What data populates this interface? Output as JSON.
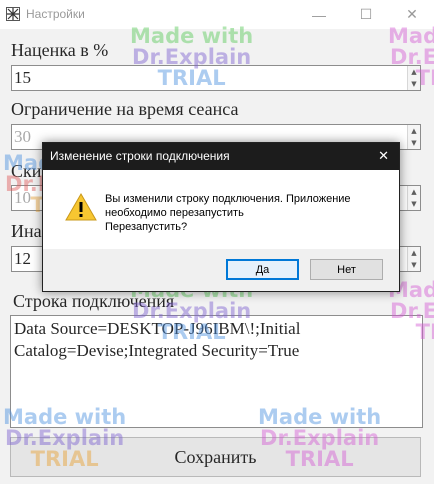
{
  "window": {
    "title": "Настройки",
    "minimize": "—",
    "maximize": "☐",
    "close": "✕"
  },
  "form": {
    "markup_label": "Наценка в %",
    "markup_value": "15",
    "session_limit_label": "Ограничение на время сеанса",
    "session_limit_value": "30",
    "discount_label": "Ски",
    "discount_value": "10",
    "other_label": "Ина",
    "other_value": "12",
    "connection_label": "Строка подключения",
    "connection_string": "Data Source=DESKTOP-J96IBM\\!;Initial Catalog=Devise;Integrated Security=True",
    "save_label": "Сохранить"
  },
  "dialog": {
    "title": "Изменение строки подключения",
    "close": "✕",
    "message_line1": "Вы изменили строку подключения. Приложение",
    "message_line2": "необходимо перезапустить",
    "message_line3": "Перезапустить?",
    "yes_label": "Да",
    "no_label": "Нет"
  },
  "watermark": {
    "line1": "Made with",
    "line2": "Dr.Explain",
    "line3": "TRIAL"
  }
}
